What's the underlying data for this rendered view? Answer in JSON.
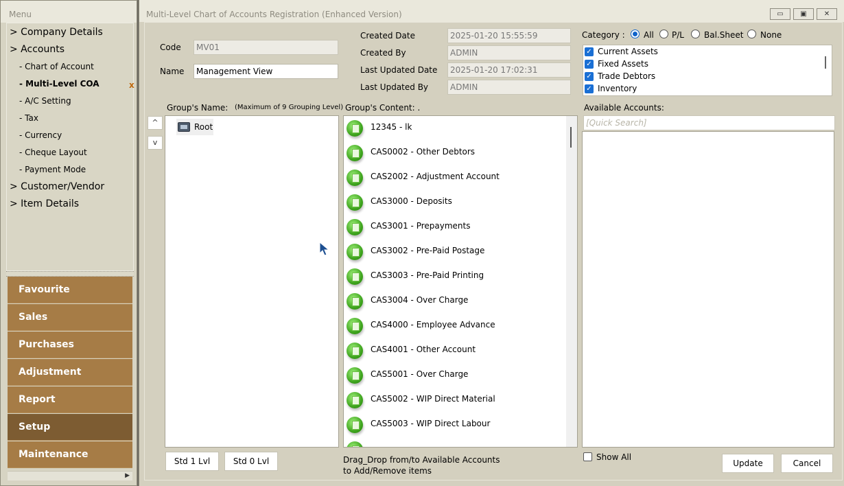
{
  "menu": {
    "title": "Menu",
    "tree": [
      {
        "label": "> Company Details"
      },
      {
        "label": "> Accounts"
      }
    ],
    "sub_items": [
      {
        "label": "- Chart of Account"
      },
      {
        "label": "- Multi-Level COA",
        "active": true
      },
      {
        "label": "- A/C Setting"
      },
      {
        "label": "- Tax"
      },
      {
        "label": "- Currency"
      },
      {
        "label": "- Cheque Layout"
      },
      {
        "label": "- Payment Mode"
      }
    ],
    "tree_after": [
      {
        "label": "> Customer/Vendor"
      },
      {
        "label": "> Item Details"
      }
    ],
    "close_mark": "x",
    "nav": [
      {
        "label": "Favourite"
      },
      {
        "label": "Sales"
      },
      {
        "label": "Purchases"
      },
      {
        "label": "Adjustment"
      },
      {
        "label": "Report"
      },
      {
        "label": "Setup",
        "active": true
      },
      {
        "label": "Maintenance"
      }
    ]
  },
  "window": {
    "title": "Multi-Level Chart of Accounts Registration (Enhanced Version)",
    "minimize": "▭",
    "maximize": "▣",
    "close": "✕"
  },
  "form": {
    "code_label": "Code",
    "code_value": "MV01",
    "name_label": "Name",
    "name_value": "Management View",
    "created_date_label": "Created Date",
    "created_date_value": "2025-01-20 15:55:59",
    "created_by_label": "Created By",
    "created_by_value": "ADMIN",
    "last_updated_date_label": "Last Updated Date",
    "last_updated_date_value": "2025-01-20 17:02:31",
    "last_updated_by_label": "Last Updated By",
    "last_updated_by_value": "ADMIN"
  },
  "category": {
    "label": "Category :",
    "options": [
      "All",
      "P/L",
      "Bal.Sheet",
      "None"
    ],
    "selected": "All",
    "items": [
      "Current Assets",
      "Fixed Assets",
      "Trade Debtors",
      "Inventory"
    ]
  },
  "groups": {
    "header": "Group's Name:",
    "note": "(Maximum of 9 Grouping Level)",
    "up_label": "^",
    "down_label": "v",
    "root_label": "Root",
    "std1_label": "Std 1 Lvl",
    "std0_label": "Std 0 Lvl"
  },
  "group_content": {
    "header": "Group's Content: .",
    "items": [
      "12345 - lk",
      "CAS0002 - Other Debtors",
      "CAS2002 - Adjustment Account",
      "CAS3000 - Deposits",
      "CAS3001 - Prepayments",
      "CAS3002 - Pre-Paid Postage",
      "CAS3003 - Pre-Paid Printing",
      "CAS3004 - Over Charge",
      "CAS4000 - Employee Advance",
      "CAS4001 - Other Account",
      "CAS5001 - Over Charge",
      "CAS5002 - WIP Direct Material",
      "CAS5003 - WIP Direct Labour"
    ],
    "hint_line1": "Drag_Drop from/to Available Accounts",
    "hint_line2": "to Add/Remove items"
  },
  "available": {
    "header": "Available Accounts:",
    "search_placeholder": "[Quick Search]",
    "show_all_label": "Show All",
    "update_label": "Update",
    "cancel_label": "Cancel"
  },
  "colors": {
    "nav_brown": "#a67c46",
    "nav_active": "#7d5c32",
    "panel_bg": "#d4d0bf",
    "radio_blue": "#0f63c9",
    "checkbox_blue": "#1a6fd4"
  }
}
